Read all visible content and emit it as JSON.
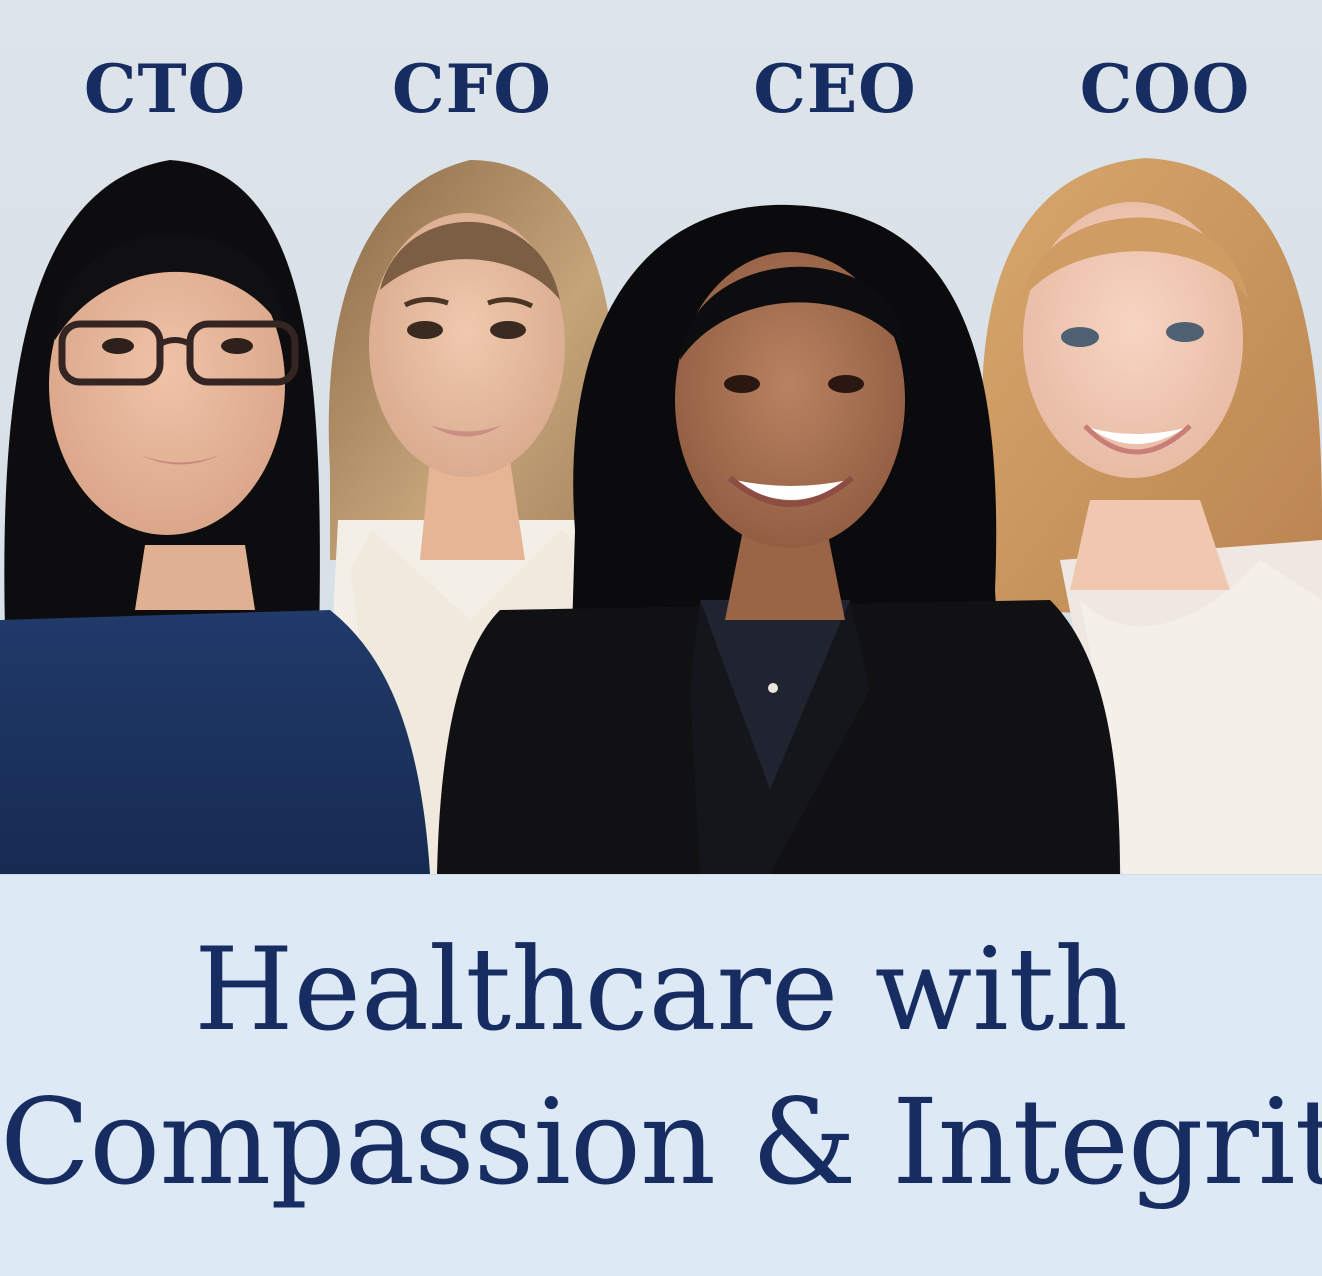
{
  "roles": [
    "CTO",
    "CFO",
    "CEO",
    "COO"
  ],
  "tagline": {
    "line1": "Healthcare with",
    "line2": "Compassion & Integrity"
  },
  "colors": {
    "accent_text": "#172d61",
    "background": "#dfe6ec",
    "banner": "#dde9f5"
  }
}
